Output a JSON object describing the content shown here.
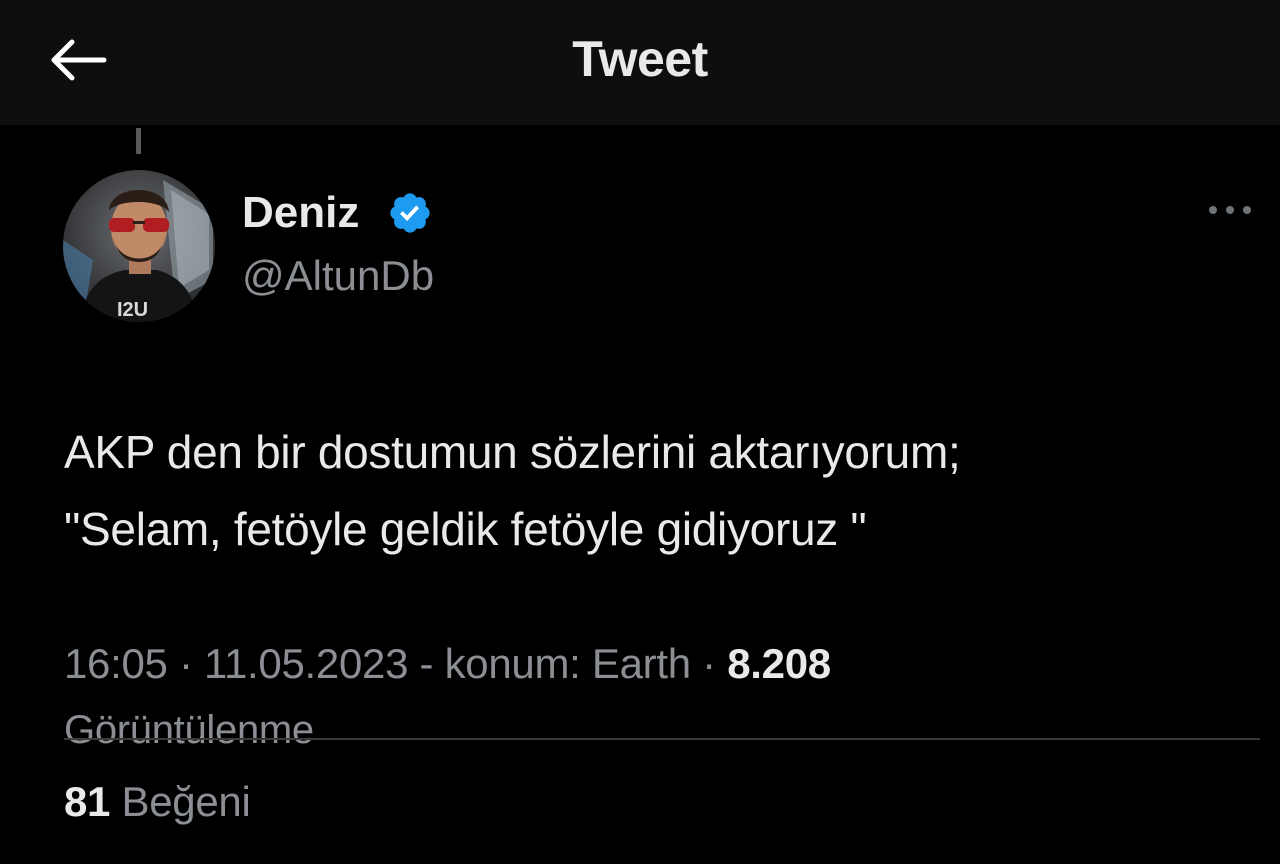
{
  "header": {
    "title": "Tweet",
    "back_icon": "arrow-left-icon"
  },
  "author": {
    "display_name": "Deniz",
    "handle": "@AltunDb",
    "verified": true,
    "verified_color": "#1d9bf0",
    "avatar_icon": "profile-photo"
  },
  "tweet": {
    "text_line1": "AKP den bir dostumun sözlerini aktarıyorum;",
    "text_line2": "\"Selam, fetöyle geldik fetöyle gidiyoruz \""
  },
  "meta": {
    "time": "16:05",
    "sep1": " · ",
    "date": "11.05.2023",
    "sep2": " - ",
    "location": "konum: Earth",
    "sep3": " · ",
    "views_count": "8.208",
    "views_label": "Görüntülenme"
  },
  "stats": {
    "likes_count": "81",
    "likes_label": "Beğeni"
  },
  "colors": {
    "background": "#000000",
    "header_background": "#0e0e0e",
    "primary_text": "#e7e9ea",
    "secondary_text": "#8b8f94",
    "accent": "#1d9bf0"
  }
}
